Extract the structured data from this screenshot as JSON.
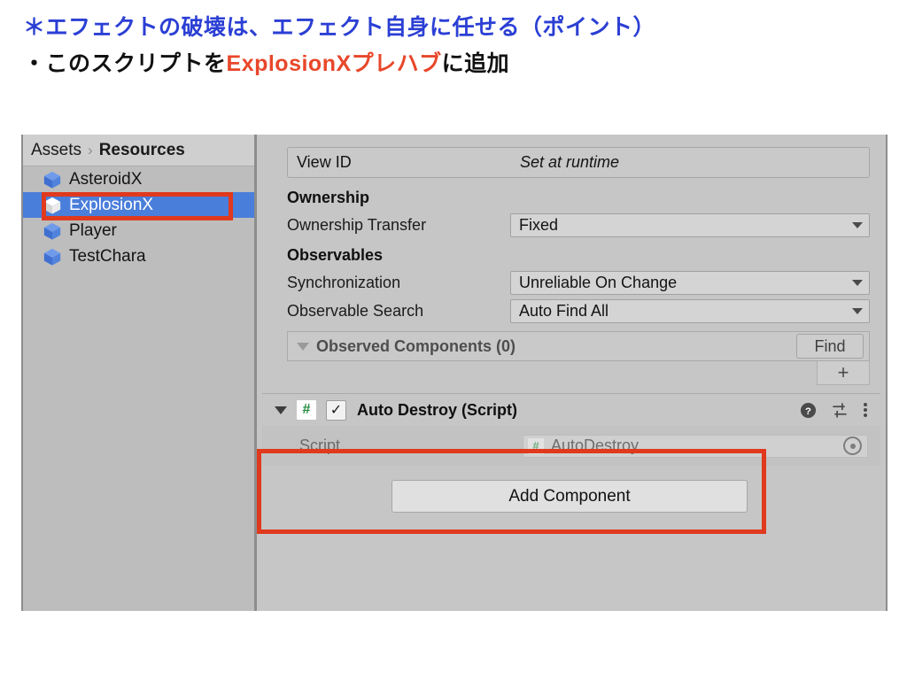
{
  "slide": {
    "line1": "＊エフェクトの破壊は、エフェクト自身に任せる（ポイント）",
    "line2_before": "・このスクリプトを",
    "line2_accent": "ExplosionXプレハブ",
    "line2_after": "に追加",
    "heading_color": "#2b3fd4",
    "accent_color": "#e8472a"
  },
  "project_panel": {
    "breadcrumb": {
      "root": "Assets",
      "separator": "›",
      "current": "Resources"
    },
    "assets": [
      {
        "label": "AsteroidX",
        "selected": false,
        "icon": "prefab-cube-icon"
      },
      {
        "label": "ExplosionX",
        "selected": true,
        "icon": "prefab-cube-icon"
      },
      {
        "label": "Player",
        "selected": false,
        "icon": "prefab-cube-icon"
      },
      {
        "label": "TestChara",
        "selected": false,
        "icon": "prefab-cube-icon"
      }
    ],
    "selection_color": "#4a7edb"
  },
  "inspector": {
    "view_id": {
      "label": "View ID",
      "value": "Set at runtime"
    },
    "ownership": {
      "header": "Ownership",
      "transfer": {
        "label": "Ownership Transfer",
        "value": "Fixed"
      }
    },
    "observables": {
      "header": "Observables",
      "synchronization": {
        "label": "Synchronization",
        "value": "Unreliable On Change"
      },
      "observable_search": {
        "label": "Observable Search",
        "value": "Auto Find All"
      }
    },
    "observed_components": {
      "title": "Observed Components (0)",
      "find_label": "Find",
      "add_label": "+"
    },
    "script_component": {
      "title": "Auto Destroy (Script)",
      "badge": "#",
      "enabled_check": "✓",
      "field_label": "Script",
      "field_badge": "#",
      "field_value": "AutoDestroy"
    },
    "add_component_label": "Add Component"
  },
  "annotations": {
    "color": "#e0391d",
    "boxes": [
      {
        "name": "explosionx-highlight"
      },
      {
        "name": "auto-destroy-component-highlight"
      }
    ]
  }
}
